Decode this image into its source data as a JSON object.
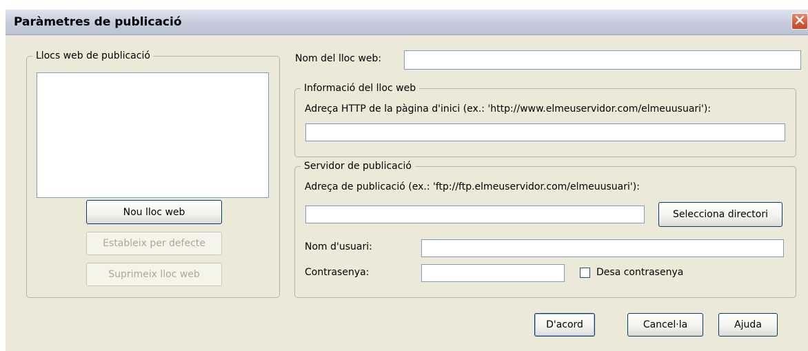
{
  "dialog": {
    "title": "Paràmetres de publicació"
  },
  "sites_group": {
    "legend": "Llocs web de publicació",
    "new_button": "Nou lloc web",
    "set_default_button": "Estableix per defecte",
    "delete_button": "Suprimeix lloc web"
  },
  "site_name": {
    "label": "Nom del lloc web:",
    "value": ""
  },
  "site_info": {
    "legend": "Informació del lloc web",
    "homepage_label": "Adreça HTTP de la pàgina d'inici (ex.: 'http://www.elmeuservidor.com/elmeuusuari'):",
    "homepage_value": ""
  },
  "server": {
    "legend": "Servidor de publicació",
    "publish_label": "Adreça de publicació (ex.: 'ftp://ftp.elmeuservidor.com/elmeuusuari'):",
    "publish_value": "",
    "select_dir_button": "Selecciona directori",
    "username_label": "Nom d'usuari:",
    "username_value": "",
    "password_label": "Contrasenya:",
    "password_value": "",
    "save_password_label": "Desa contrasenya",
    "save_password_checked": false
  },
  "footer": {
    "ok_button": "D'acord",
    "cancel_button": "Cancel·la",
    "help_button": "Ajuda"
  },
  "colors": {
    "dialog_bg": "#ece9d8",
    "titlebar": "#c6ccdc",
    "close_button": "#d65a36",
    "input_border": "#7f9db9",
    "button_border": "#003c74"
  },
  "icons": {
    "close": "close-icon"
  }
}
